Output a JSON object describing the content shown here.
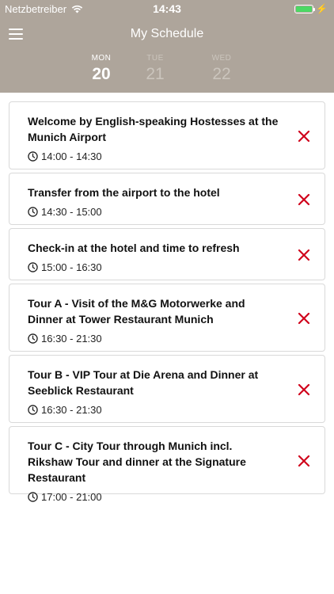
{
  "status_bar": {
    "carrier": "Netzbetreiber",
    "time": "14:43",
    "wifi_icon": "wifi-icon",
    "battery_icon": "battery-icon",
    "battery_level": 1.0,
    "charging_icon": "charging-bolt-icon",
    "charging_glyph": "⚡"
  },
  "header": {
    "title": "My Schedule",
    "menu_icon": "hamburger-menu-icon",
    "background_color": "#aea59b"
  },
  "days": [
    {
      "dow": "MON",
      "num": "20",
      "active": true
    },
    {
      "dow": "TUE",
      "num": "21",
      "active": false
    },
    {
      "dow": "WED",
      "num": "22",
      "active": false
    }
  ],
  "schedule": [
    {
      "title": "Welcome by English-speaking Hostesses at the Munich Airport",
      "time": "14:00 - 14:30"
    },
    {
      "title": "Transfer from the airport to the hotel",
      "time": "14:30 - 15:00"
    },
    {
      "title": "Check-in at the hotel and time to refresh",
      "time": "15:00 - 16:30"
    },
    {
      "title": "Tour A - Visit of the M&G Motorwerke and Dinner at Tower Restaurant Munich",
      "time": "16:30 - 21:30"
    },
    {
      "title": "Tour B - VIP Tour at Die Arena and Dinner at Seeblick Restaurant",
      "time": "16:30 - 21:30"
    },
    {
      "title": "Tour C - City Tour through Munich incl. Rikshaw Tour and dinner at the Signature Restaurant",
      "time": "17:00 - 21:00"
    }
  ],
  "icons": {
    "clock": "clock-icon",
    "remove": "remove-x-icon"
  },
  "colors": {
    "remove": "#d0021b",
    "active_day": "#ffffff",
    "inactive_day": "#cbc5bd"
  }
}
